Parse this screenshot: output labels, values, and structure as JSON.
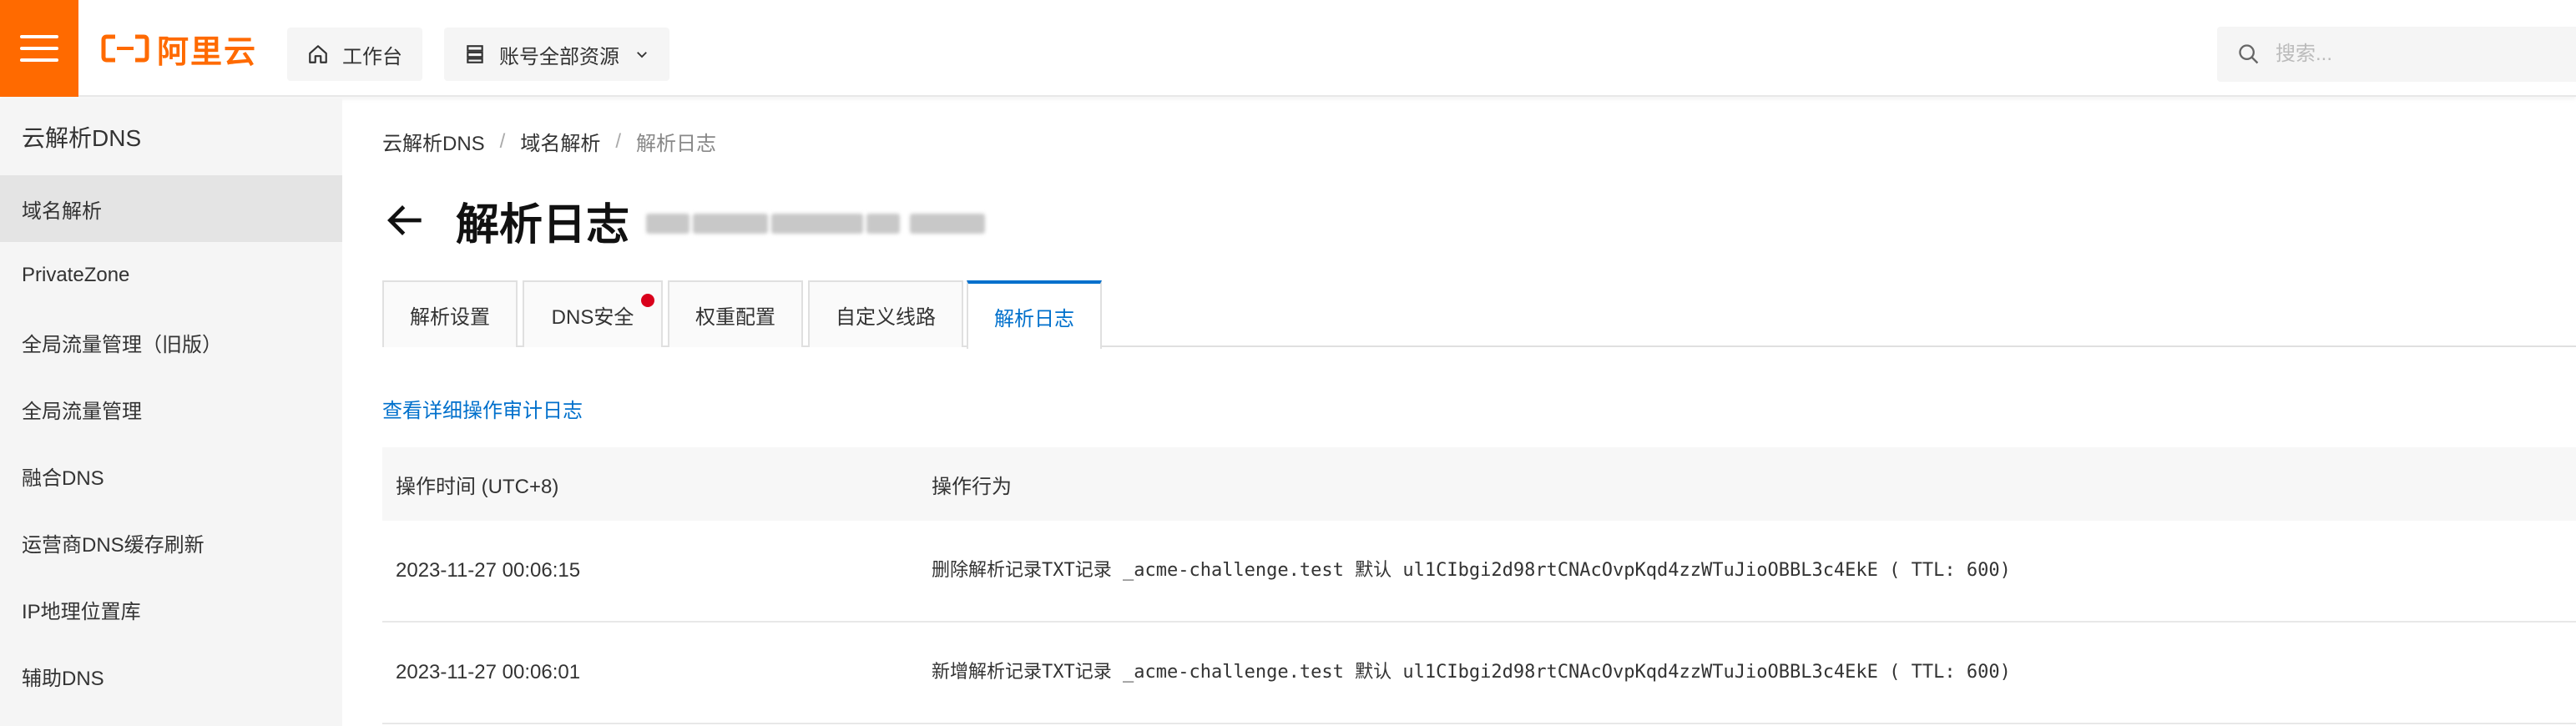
{
  "topbar": {
    "logo_text": "阿里云",
    "workbench_label": "工作台",
    "resource_scope_label": "账号全部资源",
    "search_placeholder": "搜索..."
  },
  "sidebar": {
    "title": "云解析DNS",
    "items": [
      {
        "label": "域名解析",
        "active": true
      },
      {
        "label": "PrivateZone",
        "active": false
      },
      {
        "label": "全局流量管理（旧版）",
        "active": false
      },
      {
        "label": "全局流量管理",
        "active": false
      },
      {
        "label": "融合DNS",
        "active": false
      },
      {
        "label": "运营商DNS缓存刷新",
        "active": false
      },
      {
        "label": "IP地理位置库",
        "active": false
      },
      {
        "label": "辅助DNS",
        "active": false
      }
    ]
  },
  "breadcrumb": [
    "云解析DNS",
    "域名解析",
    "解析日志"
  ],
  "page": {
    "title": "解析日志"
  },
  "tabs": [
    {
      "label": "解析设置",
      "active": false,
      "dot": false
    },
    {
      "label": "DNS安全",
      "active": false,
      "dot": true
    },
    {
      "label": "权重配置",
      "active": false,
      "dot": false
    },
    {
      "label": "自定义线路",
      "active": false,
      "dot": false
    },
    {
      "label": "解析日志",
      "active": true,
      "dot": false
    }
  ],
  "audit_link": "查看详细操作审计日志",
  "table": {
    "headers": [
      "操作时间 (UTC+8)",
      "操作行为"
    ],
    "rows": [
      {
        "time": "2023-11-27 00:06:15",
        "action": "删除解析记录TXT记录 _acme-challenge.test 默认 ul1CIbgi2d98rtCNAcOvpKqd4zzWTuJioOBBL3c4EkE ( TTL: 600)"
      },
      {
        "time": "2023-11-27 00:06:01",
        "action": "新增解析记录TXT记录 _acme-challenge.test 默认 ul1CIbgi2d98rtCNAcOvpKqd4zzWTuJioOBBL3c4EkE ( TTL: 600)"
      }
    ]
  },
  "colors": {
    "brand_orange": "#ff6a00",
    "link_blue": "#0070cc",
    "alert_red": "#d9001b"
  }
}
